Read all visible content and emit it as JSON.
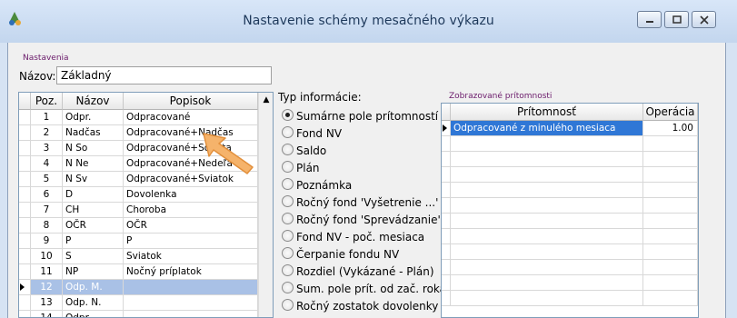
{
  "window": {
    "title": "Nastavenie schémy mesačného výkazu"
  },
  "settings": {
    "section_label": "Nastavenia",
    "name_label": "Názov:",
    "name_value": "Základný"
  },
  "items_table": {
    "headers": {
      "poz": "Poz.",
      "nazov": "Názov",
      "popisok": "Popisok"
    },
    "rows": [
      {
        "poz": "1",
        "nazov": "Odpr.",
        "popisok": "Odpracované"
      },
      {
        "poz": "2",
        "nazov": "Nadčas",
        "popisok": "Odpracované+Nadčas"
      },
      {
        "poz": "3",
        "nazov": "N So",
        "popisok": "Odpracované+Sobota"
      },
      {
        "poz": "4",
        "nazov": "N Ne",
        "popisok": "Odpracované+Nedeľa"
      },
      {
        "poz": "5",
        "nazov": "N Sv",
        "popisok": "Odpracované+Sviatok"
      },
      {
        "poz": "6",
        "nazov": "D",
        "popisok": "Dovolenka"
      },
      {
        "poz": "7",
        "nazov": "CH",
        "popisok": "Choroba"
      },
      {
        "poz": "8",
        "nazov": "OČR",
        "popisok": "OČR"
      },
      {
        "poz": "9",
        "nazov": "P",
        "popisok": "P"
      },
      {
        "poz": "10",
        "nazov": "S",
        "popisok": "Sviatok"
      },
      {
        "poz": "11",
        "nazov": "NP",
        "popisok": "Nočný príplatok"
      },
      {
        "poz": "12",
        "nazov": "Odp. M.",
        "popisok": ""
      },
      {
        "poz": "13",
        "nazov": "Odp. N.",
        "popisok": ""
      },
      {
        "poz": "14",
        "nazov": "Odpr.",
        "popisok": ""
      }
    ],
    "selected_row": 12
  },
  "info_type": {
    "label": "Typ informácie:",
    "options": [
      "Sumárne pole prítomností",
      "Fond NV",
      "Saldo",
      "Plán",
      "Poznámka",
      "Ročný fond 'Vyšetrenie ...'",
      "Ročný fond 'Sprevádzanie'",
      "Fond NV - poč. mesiaca",
      "Čerpanie fondu NV",
      "Rozdiel (Vykázané - Plán)",
      "Sum. pole prít. od zač. roka",
      "Ročný zostatok dovolenky"
    ],
    "selected": 0
  },
  "presence": {
    "section_label": "Zobrazované prítomnosti",
    "headers": {
      "pritomnost": "Prítomnosť",
      "operacia": "Operácia"
    },
    "rows": [
      {
        "pritomnost": "Odpracované z minulého mesiaca",
        "operacia": "1.00"
      }
    ]
  },
  "colors": {
    "selection": "#a9c1e6",
    "section_label": "#6a1a6a",
    "arrow": "#f5b36b"
  }
}
